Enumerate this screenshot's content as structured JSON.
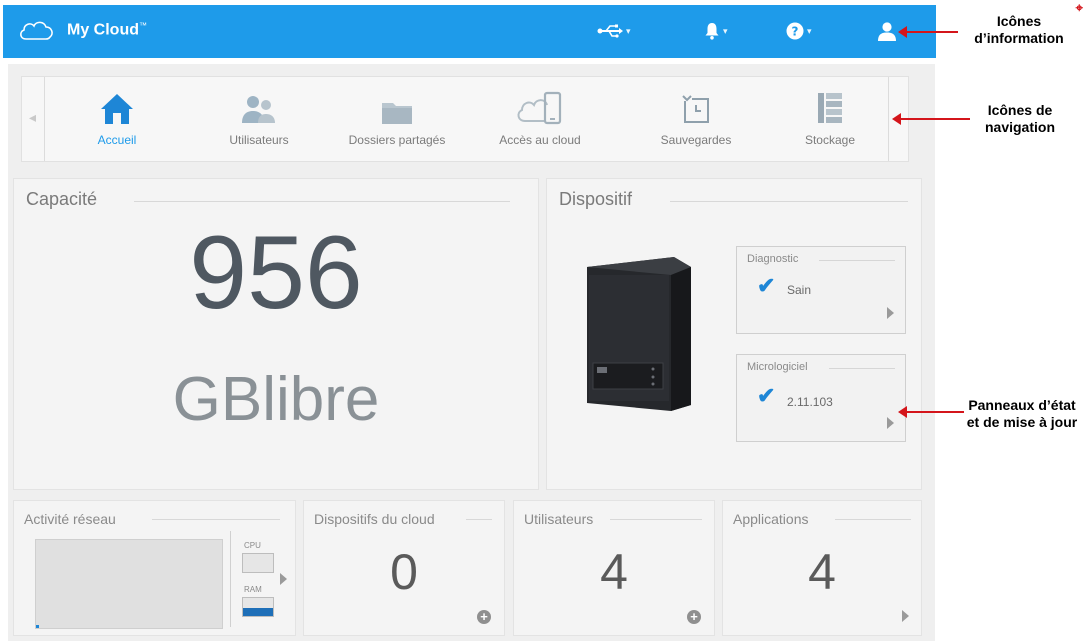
{
  "topbar": {
    "brand": "My Cloud",
    "brand_mark": "™",
    "icons": [
      "usb-icon",
      "bell-icon",
      "help-icon",
      "user-icon"
    ],
    "colors": {
      "bar": "#1e9bea"
    }
  },
  "nav": {
    "items": [
      {
        "label": "Accueil",
        "icon": "home-icon",
        "active": true
      },
      {
        "label": "Utilisateurs",
        "icon": "users-icon"
      },
      {
        "label": "Dossiers partagés",
        "icon": "folder-icon"
      },
      {
        "label": "Accès au cloud",
        "icon": "cloud-device-icon"
      },
      {
        "label": "Sauvegardes",
        "icon": "backup-icon"
      },
      {
        "label": "Stockage",
        "icon": "storage-icon"
      }
    ]
  },
  "capacity": {
    "title": "Capacité",
    "value": "956",
    "unit": "GBlibre"
  },
  "device": {
    "title": "Dispositif",
    "diagnostic": {
      "title": "Diagnostic",
      "value": "Sain"
    },
    "firmware": {
      "title": "Micrologiciel",
      "value": "2.11.103"
    }
  },
  "network": {
    "title": "Activité réseau",
    "cpu_label": "CPU",
    "ram_label": "RAM",
    "ram_level": 0.45
  },
  "cloud_devices": {
    "title": "Dispositifs du cloud",
    "value": "0"
  },
  "users": {
    "title": "Utilisateurs",
    "value": "4"
  },
  "apps": {
    "title": "Applications",
    "value": "4"
  },
  "annotations": {
    "info_icons": "Icônes d’information",
    "nav_icons": "Icônes de navigation",
    "status_panels": "Panneaux d’état et de mise à jour"
  }
}
